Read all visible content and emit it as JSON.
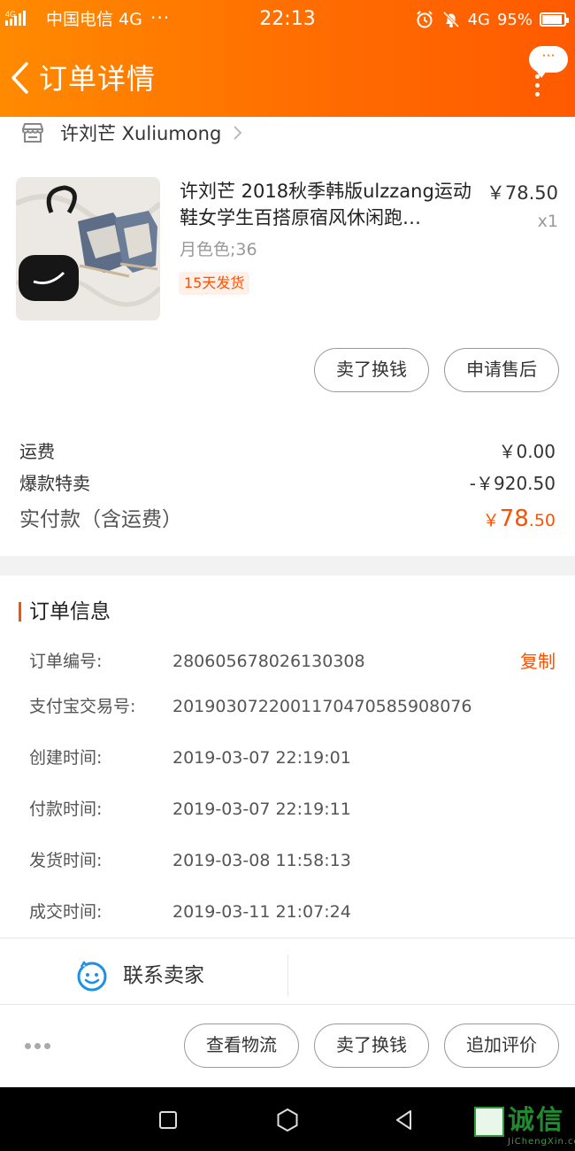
{
  "status_bar": {
    "network_badge": "4G",
    "carrier": "中国电信 4G",
    "overflow": "···",
    "time": "22:13",
    "network": "4G",
    "battery_label": "95%"
  },
  "nav": {
    "title": "订单详情",
    "more_bubble": "···"
  },
  "shop": {
    "name": "许刘芒 Xuliumong"
  },
  "product": {
    "title": "许刘芒 2018秋季韩版ulzzang运动鞋女学生百搭原宿风休闲跑…",
    "price": "￥78.50",
    "quantity": "x1",
    "sku": "月色色;36",
    "shipping_badge": "15天发货"
  },
  "item_actions": {
    "sell_label": "卖了换钱",
    "after_sale_label": "申请售后"
  },
  "summary": {
    "shipping_label": "运费",
    "shipping_value": "￥0.00",
    "discount_label": "爆款特卖",
    "discount_value": "-￥920.50",
    "paid_label": "实付款（含运费）",
    "paid_currency": "￥",
    "paid_int": "78",
    "paid_dec": ".50"
  },
  "order_info": {
    "title": "订单信息",
    "copy_label": "复制",
    "rows": [
      {
        "label": "订单编号:",
        "value": "280605678026130308"
      },
      {
        "label": "支付宝交易号:",
        "value": "2019030722001170470585908076"
      },
      {
        "label": "创建时间:",
        "value": "2019-03-07 22:19:01"
      },
      {
        "label": "付款时间:",
        "value": "2019-03-07 22:19:11"
      },
      {
        "label": "发货时间:",
        "value": "2019-03-08 11:58:13"
      },
      {
        "label": "成交时间:",
        "value": "2019-03-11 21:07:24"
      }
    ]
  },
  "contact": {
    "label": "联系卖家"
  },
  "bottom_actions": {
    "logistics_label": "查看物流",
    "sell_label": "卖了换钱",
    "review_label": "追加评价"
  },
  "watermark": {
    "text": "诚信",
    "sub": "JiChengXin.com"
  },
  "colors": {
    "brand_orange": "#ff6a00",
    "accent_red": "#ff5000",
    "contact_blue": "#1e90e6"
  }
}
